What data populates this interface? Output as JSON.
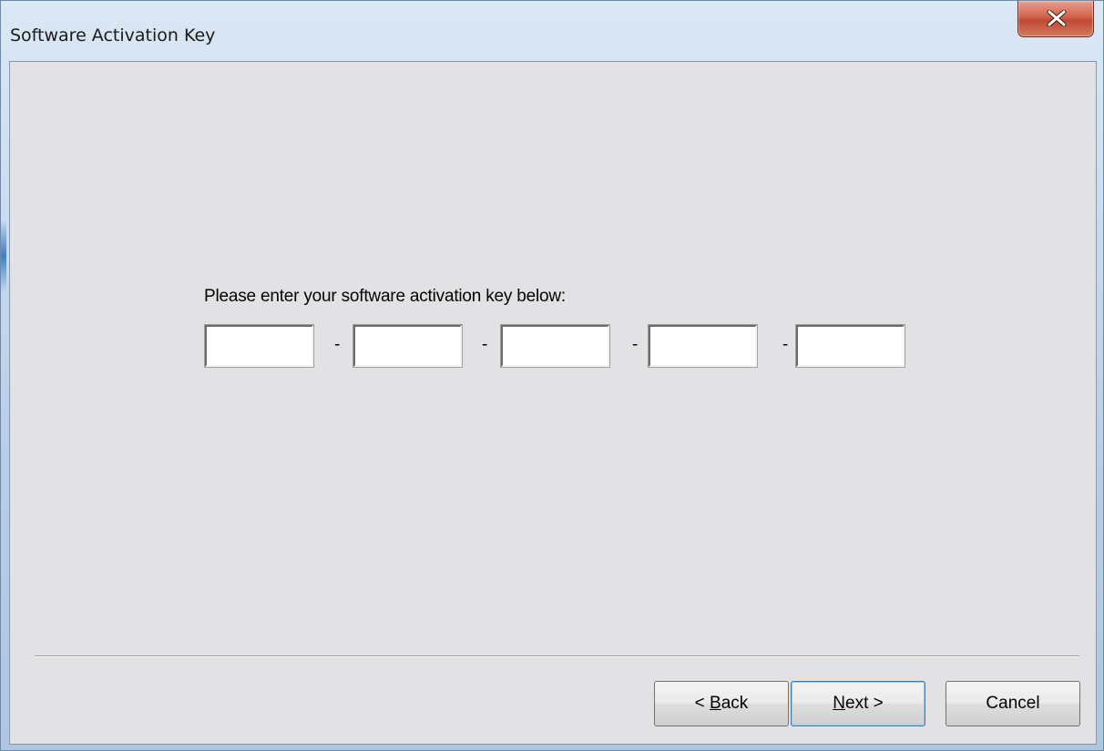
{
  "window": {
    "title": "Software Activation Key"
  },
  "content": {
    "prompt": "Please enter your software activation key below:",
    "key_fields": [
      {
        "value": ""
      },
      {
        "value": ""
      },
      {
        "value": ""
      },
      {
        "value": ""
      },
      {
        "value": ""
      }
    ],
    "separator_char": "-"
  },
  "buttons": {
    "back": {
      "prefix": "< ",
      "mnemonic": "B",
      "rest": "ack"
    },
    "next": {
      "mnemonic": "N",
      "rest": "ext >"
    },
    "cancel": {
      "label": "Cancel"
    }
  },
  "icons": {
    "close": "close-icon"
  },
  "colors": {
    "close_button": "#c8553f",
    "dialog_background": "#e2e2e4",
    "default_button_border": "#3c7fb1"
  }
}
